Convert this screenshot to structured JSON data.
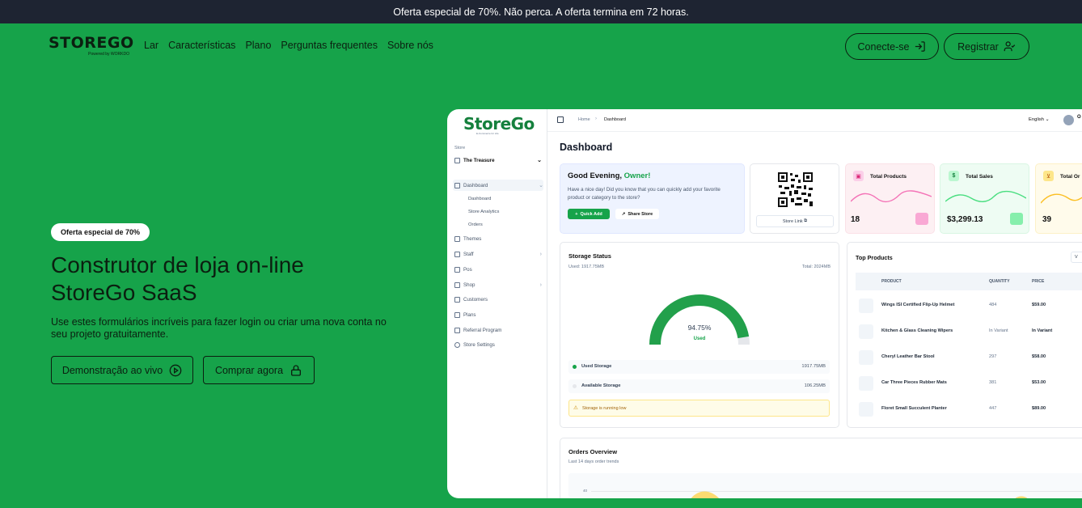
{
  "announcement": "Oferta especial de 70%. Não perca. A oferta termina em 72 horas.",
  "brand": {
    "name": "STOREGO",
    "tagline": "Powered by WORKDO",
    "accent": "#16a34a",
    "dark": "#1e2432"
  },
  "nav": {
    "links": [
      "Lar",
      "Características",
      "Plano",
      "Perguntas frequentes",
      "Sobre nós"
    ],
    "login_label": "Conecte-se",
    "register_label": "Registrar"
  },
  "hero": {
    "badge": "Oferta especial de 70%",
    "title_line1": "Construtor de loja on-line",
    "title_line2": "StoreGo SaaS",
    "description": "Use estes formulários incríveis para fazer login ou criar uma nova conta no seu projeto gratuitamente.",
    "demo_label": "Demonstração ao vivo",
    "buy_label": "Comprar agora"
  },
  "dashboard": {
    "logo": "StoreGo",
    "logo_sub": "E-Commerce for Life",
    "store_label": "Store",
    "store_name": "The Treasure",
    "sidebar": {
      "dashboard": "Dashboard",
      "sub": [
        "Dashboard",
        "Store Analytics",
        "Orders"
      ],
      "items": [
        "Themes",
        "Staff",
        "Pos",
        "Shop",
        "Customers",
        "Plans",
        "Referral Program",
        "Store Settings"
      ]
    },
    "breadcrumb_home": "Home",
    "breadcrumb_current": "Dashboard",
    "language": "English",
    "user_initial": "O",
    "page_title": "Dashboard",
    "greeting_prefix": "Good Evening, ",
    "greeting_name": "Owner!",
    "greeting_text": "Have a nice day! Did you know that you can quickly add your favorite product or category to the store?",
    "quick_add": "Quick Add",
    "share_store": "Share Store",
    "store_link": "Store Link",
    "stats": [
      {
        "label": "Total Products",
        "value": "18"
      },
      {
        "label": "Total Sales",
        "value": "$3,299.13"
      },
      {
        "label": "Total Or",
        "value": "39"
      }
    ],
    "storage": {
      "title": "Storage Status",
      "used": "Used: 1917.75MB",
      "total": "Total: 2024MB",
      "percent_label": "94.75%",
      "percent": 94.75,
      "used_caption": "Used",
      "used_storage_label": "Used Storage",
      "used_storage_value": "1917.75MB",
      "available_label": "Available Storage",
      "available_value": "106.25MB",
      "warning": "Storage is running low"
    },
    "top_products": {
      "title": "Top Products",
      "headers": [
        "PRODUCT",
        "QUANTITY",
        "PRICE"
      ],
      "rows": [
        {
          "name": "Wings ISI Certified Flip-Up Helmet",
          "qty": "484",
          "price": "$59.00"
        },
        {
          "name": "Kitchen & Glass Cleaning Wipers",
          "qty": "In Variant",
          "price": "In Variant"
        },
        {
          "name": "Cheryl Leather Bar Stool",
          "qty": "297",
          "price": "$58.00"
        },
        {
          "name": "Car Three Pieces Rubber Mats",
          "qty": "381",
          "price": "$53.00"
        },
        {
          "name": "Floret Small Succulent Planter",
          "qty": "447",
          "price": "$89.00"
        }
      ]
    },
    "orders": {
      "title": "Orders Overview",
      "subtitle": "Last 14 days order trends",
      "tick": "40"
    }
  }
}
